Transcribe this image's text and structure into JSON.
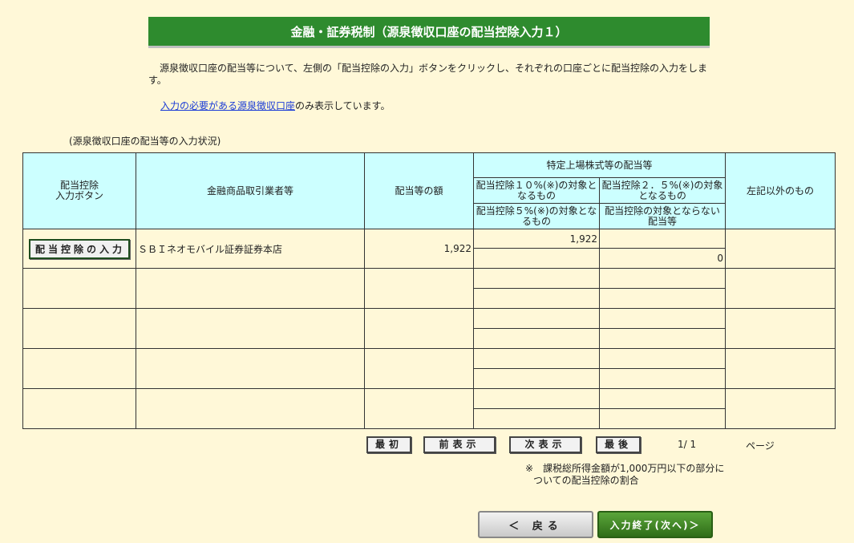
{
  "page": {
    "title": "金融・証券税制（源泉徴収口座の配当控除入力１）",
    "intro": "源泉徴収口座の配当等について、左側の「配当控除の入力」ボタンをクリックし、それぞれの口座ごとに配当控除の入力をします。",
    "note_link": "入力の必要がある源泉徴収口座",
    "note_suffix": "のみ表示しています。",
    "table_caption": "(源泉徴収口座の配当等の入力状況)"
  },
  "table": {
    "headers": {
      "button_col": [
        "配当控除",
        "入力ボタン"
      ],
      "broker": "金融商品取引業者等",
      "amount": "配当等の額",
      "listed_group": "特定上場株式等の配当等",
      "pct10": "配当控除１０%(※)の対象となるもの",
      "pct25": "配当控除２．５%(※)の対象となるもの",
      "pct5": "配当控除５%(※)の対象となるもの",
      "no_credit": "配当控除の対象とならない配当等",
      "other": "左記以外のもの"
    },
    "rows": [
      {
        "button": "配当控除の入力",
        "broker": "ＳＢＩネオモバイル証券証券本店",
        "amount": "1,922",
        "pct10": "1,922",
        "pct25": "",
        "pct5": "",
        "no_credit": "0",
        "other": ""
      }
    ]
  },
  "pager": {
    "first": "最初",
    "prev": "前表示",
    "next": "次表示",
    "last": "最後",
    "count": "1/ 1",
    "label": "ページ"
  },
  "footnote": [
    "※　課税総所得金額が1,000万円以下の部分に",
    "ついての配当控除の割合"
  ],
  "nav": {
    "back": "＜ 戻る",
    "next": "入力終了(次へ)＞"
  }
}
